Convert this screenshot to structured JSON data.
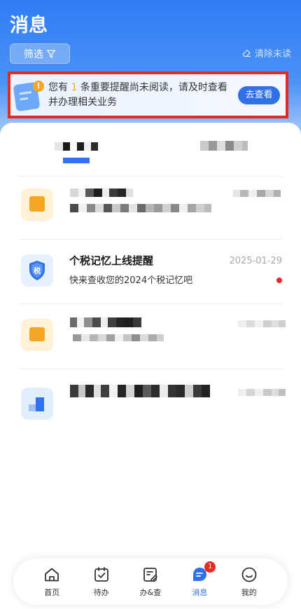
{
  "header": {
    "title": "消息",
    "filter_label": "筛选",
    "clear_label": "清除未读"
  },
  "notice": {
    "text_before": "您有 ",
    "count": "1",
    "text_after": " 条重要提醒尚未阅读，请及时查看并办理相关业务",
    "action_label": "去查看"
  },
  "messages": [
    {
      "title": "个税记忆上线提醒",
      "subtitle": "快来查收您的2024个税记忆吧",
      "date": "2025-01-29",
      "unread": true
    }
  ],
  "tabbar": {
    "items": [
      {
        "label": "首页",
        "icon": "home-icon"
      },
      {
        "label": "待办",
        "icon": "todo-icon"
      },
      {
        "label": "办&查",
        "icon": "handle-query-icon"
      },
      {
        "label": "消息",
        "icon": "message-icon",
        "badge": "1",
        "active": true
      },
      {
        "label": "我的",
        "icon": "profile-icon"
      }
    ]
  },
  "colors": {
    "primary": "#2f6fe8",
    "alert_border": "#e8291f",
    "badge": "#e8291f",
    "highlight": "#f5a623"
  }
}
